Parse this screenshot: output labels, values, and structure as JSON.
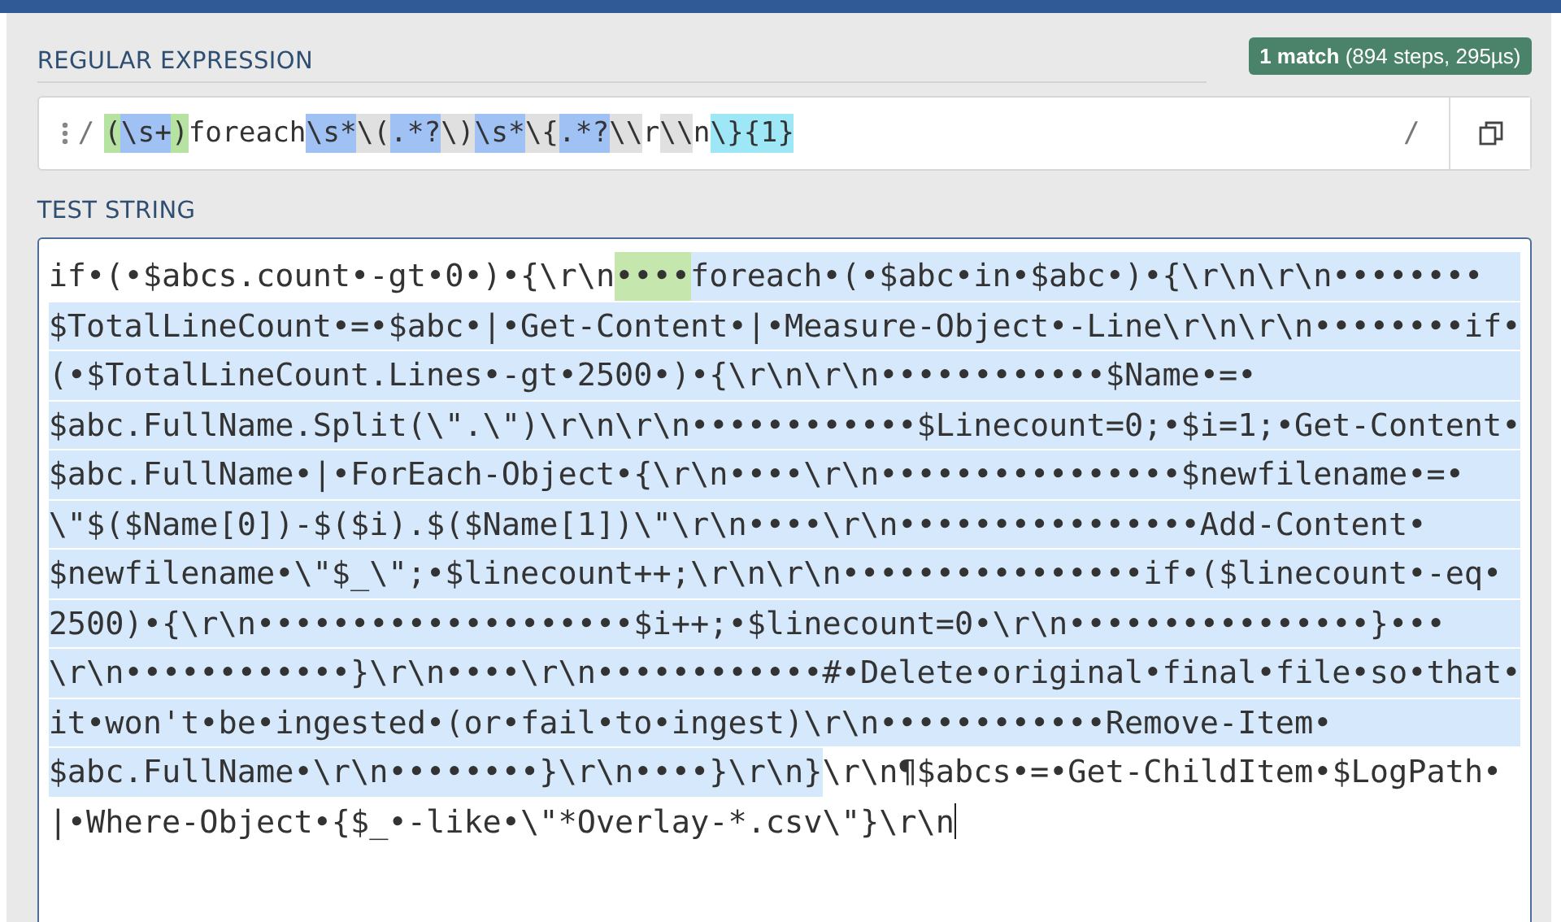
{
  "regex_panel": {
    "title": "REGULAR EXPRESSION",
    "match_info": "**1 match** (894 steps, 295µs)",
    "delimiter_open": "/",
    "delimiter_close": "/",
    "tokens": [
      {
        "text": "(",
        "kind": "group"
      },
      {
        "text": "\\s+",
        "kind": "class"
      },
      {
        "text": ")",
        "kind": "group"
      },
      {
        "text": "foreach",
        "kind": "plain"
      },
      {
        "text": "\\s*",
        "kind": "class"
      },
      {
        "text": "\\(",
        "kind": "escape"
      },
      {
        "text": ".*?",
        "kind": "class"
      },
      {
        "text": "\\)",
        "kind": "escape"
      },
      {
        "text": "\\s*",
        "kind": "class"
      },
      {
        "text": "\\{",
        "kind": "escape"
      },
      {
        "text": ".*?",
        "kind": "class"
      },
      {
        "text": "\\\\",
        "kind": "escape"
      },
      {
        "text": "r",
        "kind": "plain"
      },
      {
        "text": "\\\\",
        "kind": "escape"
      },
      {
        "text": "n",
        "kind": "plain"
      },
      {
        "text": "\\}{1}",
        "kind": "quant"
      }
    ]
  },
  "test_panel": {
    "title": "TEST STRING",
    "lines": [
      [
        {
          "text": "if•(•$abcs.count•-gt•0•)•{\\r\\n",
          "kind": "plain"
        },
        {
          "text": "••••",
          "kind": "group"
        },
        {
          "text": "foreach•(•$abc•in•$abc•)•{\\r\\n\\r\\n••••••••",
          "kind": "match"
        }
      ],
      [
        {
          "text": "$TotalLineCount•=•$abc•|•Get-Content•|•Measure-Object•-Line\\r\\n\\r\\n••••••••if•",
          "kind": "match"
        }
      ],
      [
        {
          "text": "(•$TotalLineCount.Lines•-gt•2500•)•{\\r\\n\\r\\n••••••••••••$Name•=•",
          "kind": "match"
        }
      ],
      [
        {
          "text": "$abc.FullName.Split(\\\".\\\")\\r\\n\\r\\n••••••••••••$Linecount=0;•$i=1;•Get-Content•",
          "kind": "match"
        }
      ],
      [
        {
          "text": "$abc.FullName•|•ForEach-Object•{\\r\\n••••\\r\\n••••••••••••••••$newfilename•=•",
          "kind": "match"
        }
      ],
      [
        {
          "text": "\\\"$($Name[0])-$($i).$($Name[1])\\\"\\r\\n••••\\r\\n••••••••••••••••Add-Content•",
          "kind": "match"
        }
      ],
      [
        {
          "text": "$newfilename•\\\"$_\\\";•$linecount++;\\r\\n\\r\\n••••••••••••••••if•($linecount•-eq•",
          "kind": "match"
        }
      ],
      [
        {
          "text": "2500)•{\\r\\n••••••••••••••••••••$i++;•$linecount=0•\\r\\n••••••••••••••••}•••",
          "kind": "match"
        }
      ],
      [
        {
          "text": "\\r\\n••••••••••••}\\r\\n••••\\r\\n••••••••••••#•Delete•original•final•file•so•that•",
          "kind": "match"
        }
      ],
      [
        {
          "text": "it•won't•be•ingested•(or•fail•to•ingest)\\r\\n••••••••••••Remove-Item•",
          "kind": "match"
        }
      ],
      [
        {
          "text": "$abc.FullName•\\r\\n••••••••}\\r\\n••••}\\r\\n}",
          "kind": "match"
        },
        {
          "text": "\\r\\n¶$abcs•=•Get-ChildItem•$LogPath•",
          "kind": "plain"
        }
      ],
      [
        {
          "text": "|•Where-Object•{$_•-like•\\\"*Overlay-*.csv\\\"}\\r\\n",
          "kind": "plain"
        }
      ]
    ]
  }
}
